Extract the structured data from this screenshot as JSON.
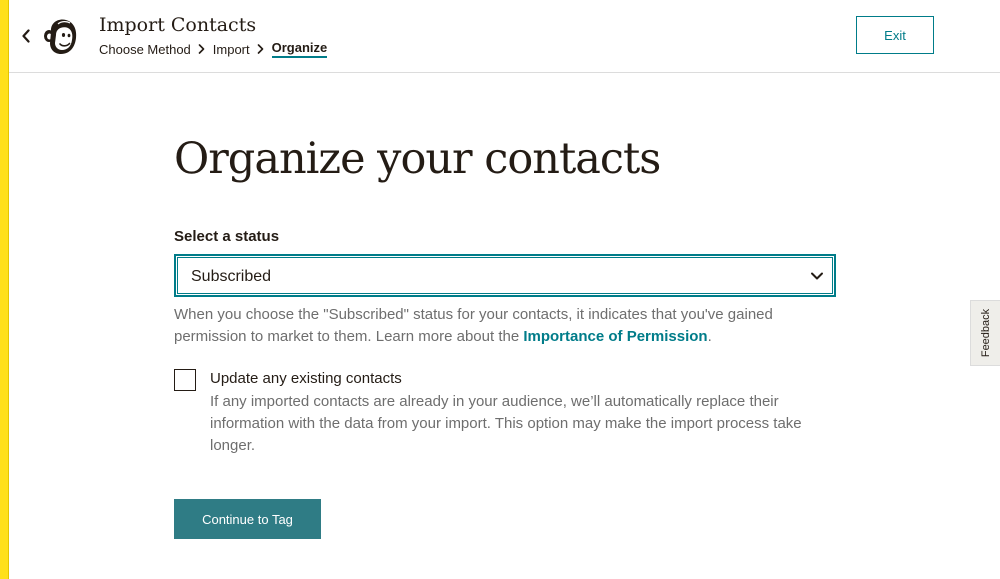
{
  "header": {
    "title": "Import Contacts",
    "breadcrumb": [
      {
        "label": "Choose Method"
      },
      {
        "label": "Import"
      },
      {
        "label": "Organize"
      }
    ],
    "exit_label": "Exit"
  },
  "main": {
    "title": "Organize your contacts",
    "status_label": "Select a status",
    "status_value": "Subscribed",
    "helper_text": "When you choose the \"Subscribed\" status for your contacts, it indicates that you've gained permission to market to them. Learn more about the ",
    "helper_link": "Importance of Permission",
    "helper_end": ".",
    "update_label": "Update any existing contacts",
    "update_description": "If any imported contacts are already in your audience, we’ll automatically replace their information with the data from your import. This option may make the import process take longer.",
    "update_checked": false,
    "continue_label": "Continue to Tag"
  },
  "feedback_label": "Feedback",
  "colors": {
    "accent": "#007c89",
    "button": "#2f7c85",
    "brand_yellow": "#ffe01b",
    "text": "#241c15",
    "muted": "#6e6e6e"
  },
  "icons": {
    "back": "chevron-left-icon",
    "logo": "mailchimp-logo-icon",
    "separator": "chevron-right-icon",
    "dropdown": "chevron-down-icon"
  }
}
